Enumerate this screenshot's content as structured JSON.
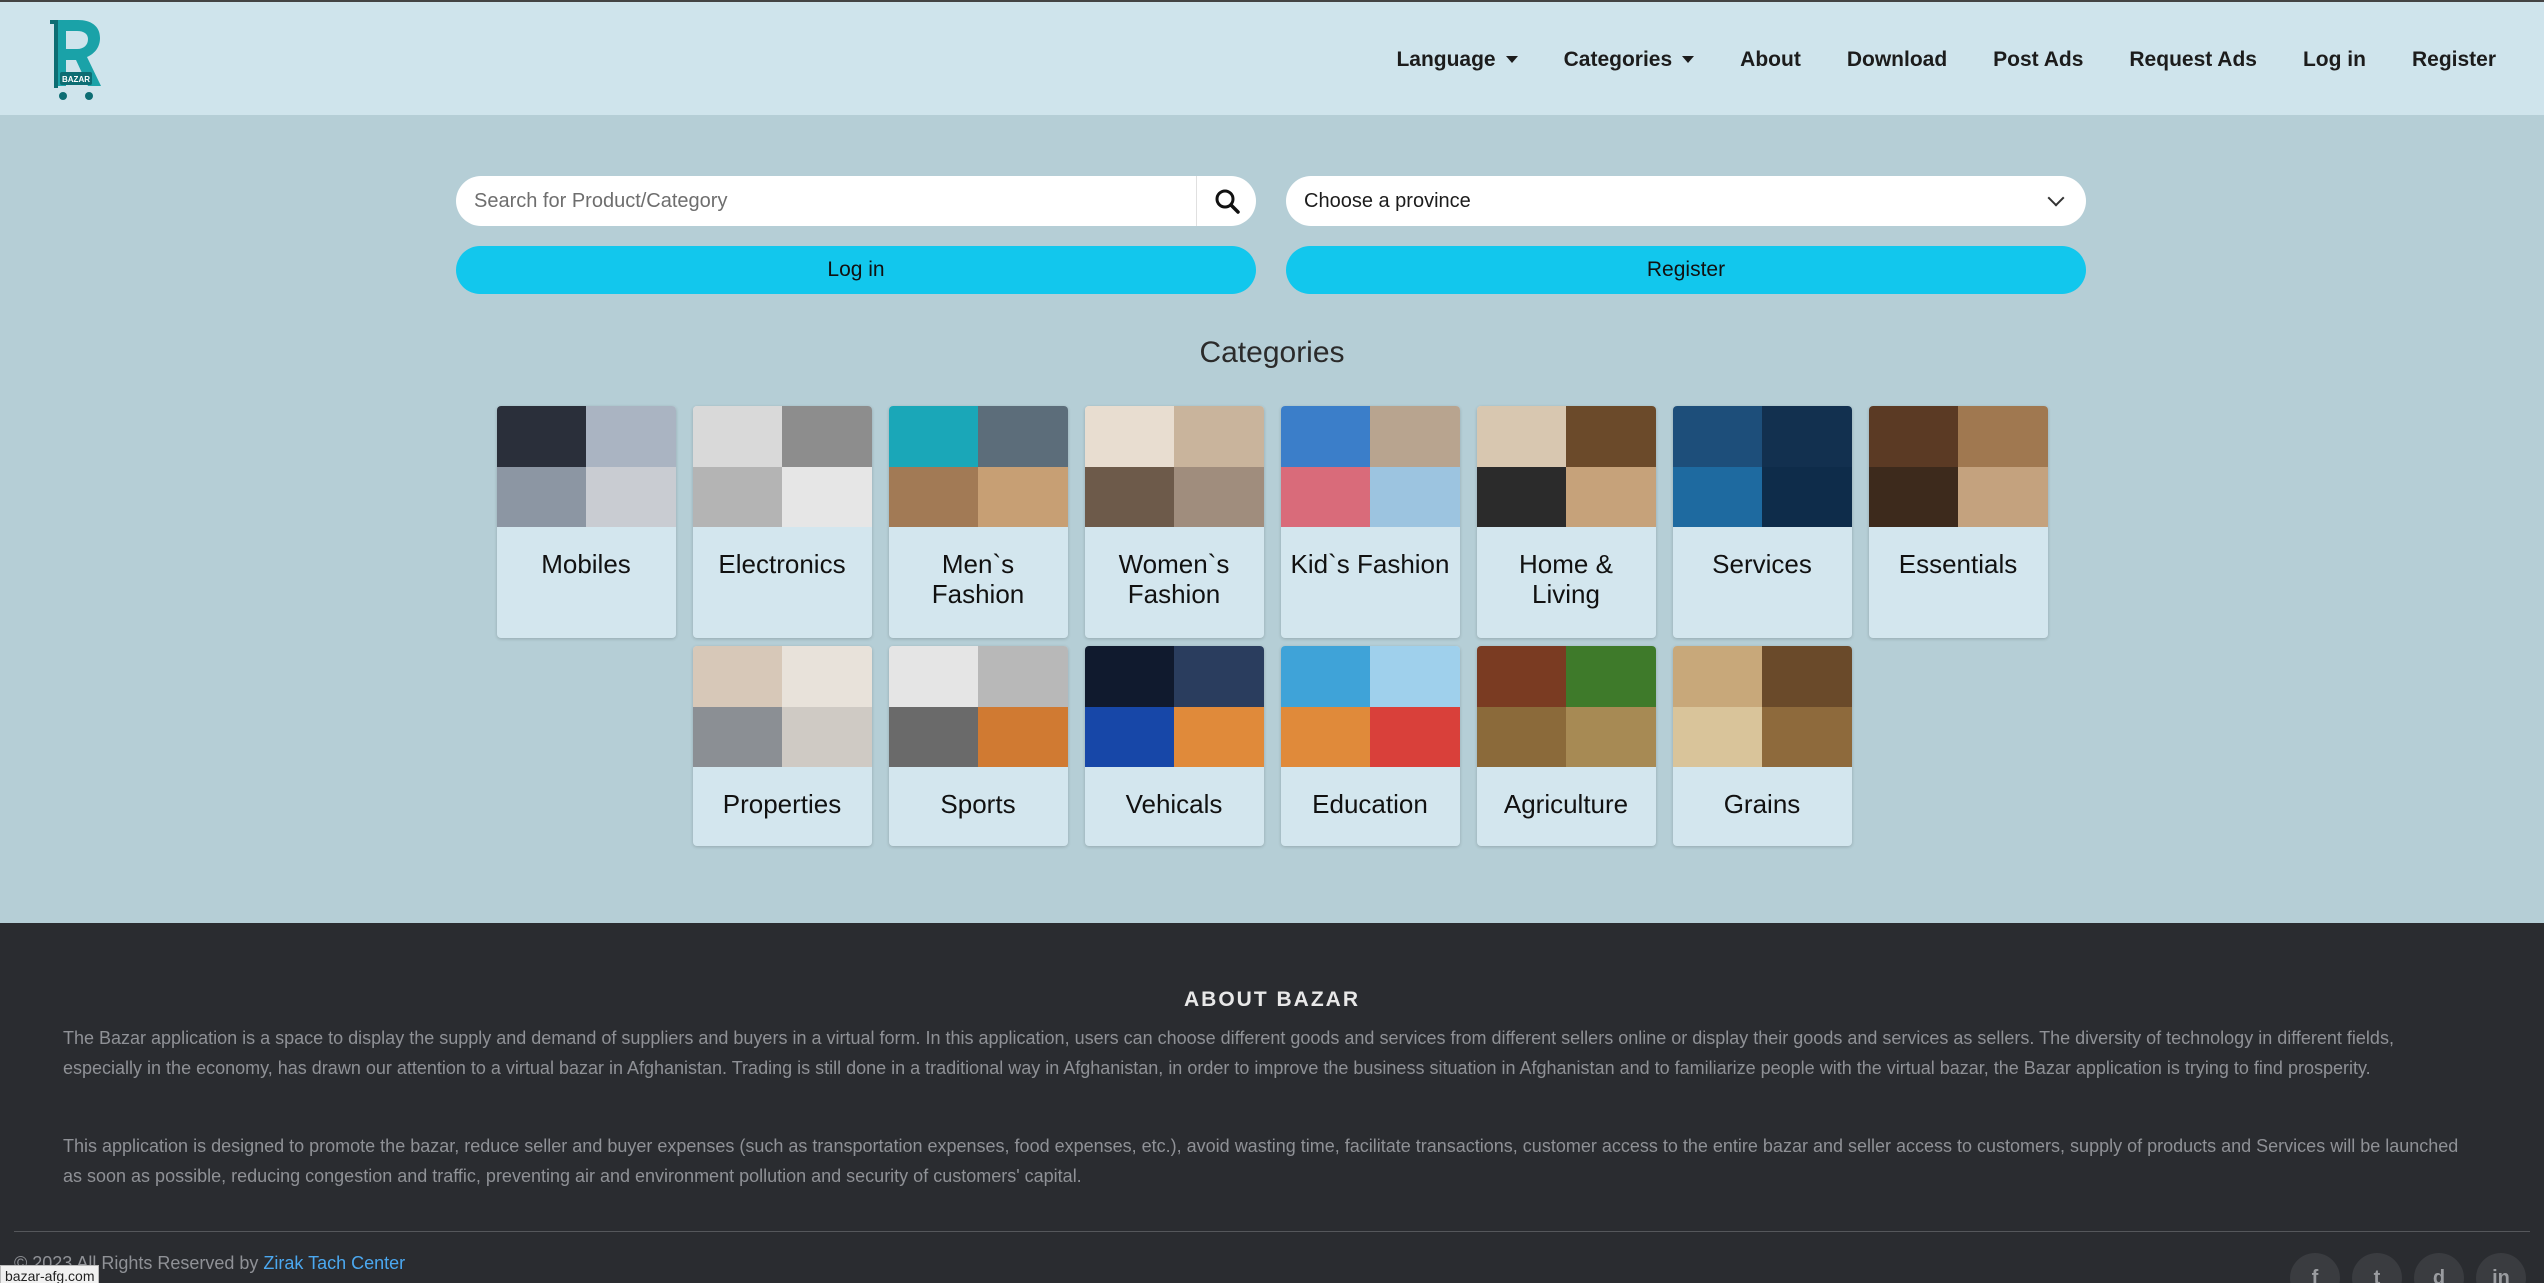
{
  "navbar": {
    "logo_text": "BAZAR",
    "items": [
      {
        "label": "Language",
        "dropdown": true
      },
      {
        "label": "Categories",
        "dropdown": true
      },
      {
        "label": "About",
        "dropdown": false
      },
      {
        "label": "Download",
        "dropdown": false
      },
      {
        "label": "Post Ads",
        "dropdown": false
      },
      {
        "label": "Request Ads",
        "dropdown": false
      },
      {
        "label": "Log in",
        "dropdown": false
      },
      {
        "label": "Register",
        "dropdown": false
      }
    ]
  },
  "search": {
    "placeholder": "Search for Product/Category",
    "value": ""
  },
  "province": {
    "selected": "Choose a province"
  },
  "buttons": {
    "login": "Log in",
    "register": "Register"
  },
  "categories": {
    "title": "Categories",
    "row1": [
      {
        "label": "Mobiles",
        "colors": [
          "#2a2f3a",
          "#aab4c2",
          "#8c96a3",
          "#c9ccd2"
        ]
      },
      {
        "label": "Electronics",
        "colors": [
          "#d9d9d9",
          "#8d8d8d",
          "#b4b4b4",
          "#e6e6e6"
        ]
      },
      {
        "label": "Men`s Fashion",
        "colors": [
          "#1aa7b8",
          "#5c6d7a",
          "#a27a55",
          "#c79f74"
        ]
      },
      {
        "label": "Women`s Fashion",
        "colors": [
          "#e8ddd0",
          "#c9b49c",
          "#6d5a4a",
          "#a08d7d"
        ]
      },
      {
        "label": "Kid`s Fashion",
        "colors": [
          "#3b7ec9",
          "#b8a48f",
          "#d96b7a",
          "#9cc4e0"
        ]
      },
      {
        "label": "Home & Living",
        "colors": [
          "#d8c7b0",
          "#6b4a2a",
          "#2b2b2b",
          "#c6a27a"
        ]
      },
      {
        "label": "Services",
        "colors": [
          "#1d4e7a",
          "#12304f",
          "#1e6aa0",
          "#0e2c4a"
        ]
      },
      {
        "label": "Essentials",
        "colors": [
          "#5b3a24",
          "#a07850",
          "#3d2a1c",
          "#c4a27e"
        ]
      }
    ],
    "row2": [
      {
        "label": "Properties",
        "colors": [
          "#d7c8b8",
          "#e8e2da",
          "#8b8f94",
          "#cfcac4"
        ]
      },
      {
        "label": "Sports",
        "colors": [
          "#e5e5e5",
          "#b8b8b8",
          "#6a6a6a",
          "#d07a32"
        ]
      },
      {
        "label": "Vehicals",
        "colors": [
          "#101a2e",
          "#2a3d5e",
          "#1747a8",
          "#e08a3a"
        ]
      },
      {
        "label": "Education",
        "colors": [
          "#3fa3d8",
          "#9fd0ec",
          "#e08a3a",
          "#d9403a"
        ]
      },
      {
        "label": "Agriculture",
        "colors": [
          "#7a3b22",
          "#3e7a2a",
          "#8b6a3a",
          "#a78a54"
        ]
      },
      {
        "label": "Grains",
        "colors": [
          "#c8a87a",
          "#6a4a2a",
          "#d9c49a",
          "#8e6a3c"
        ]
      }
    ]
  },
  "footer": {
    "about_title": "ABOUT BAZAR",
    "paragraph1": "The Bazar application is a space to display the supply and demand of suppliers and buyers in a virtual form. In this application, users can choose different goods and services from different sellers online or display their goods and services as sellers. The diversity of technology in different fields, especially in the economy, has drawn our attention to a virtual bazar in Afghanistan. Trading is still done in a traditional way in Afghanistan, in order to improve the business situation in Afghanistan and to familiarize people with the virtual bazar, the Bazar application is trying to find prosperity.",
    "paragraph2": "This application is designed to promote the bazar, reduce seller and buyer expenses (such as transportation expenses, food expenses, etc.), avoid wasting time, facilitate transactions, customer access to the entire bazar and seller access to customers, supply of products and Services will be launched as soon as possible, reducing congestion and traffic, preventing air and environment pollution and security of customers' capital.",
    "copyright_prefix": "© 2023 All Rights Reserved by ",
    "copyright_link": "Zirak Tach Center",
    "status_url": "bazar-afg.com",
    "social": [
      "f",
      "t",
      "d",
      "in"
    ]
  },
  "colors": {
    "accent": "#12c7ed",
    "nav_bg": "#cfe4ec",
    "page_bg": "#b5ced6",
    "footer_bg": "#2a2c30",
    "link": "#4ba8f0"
  }
}
